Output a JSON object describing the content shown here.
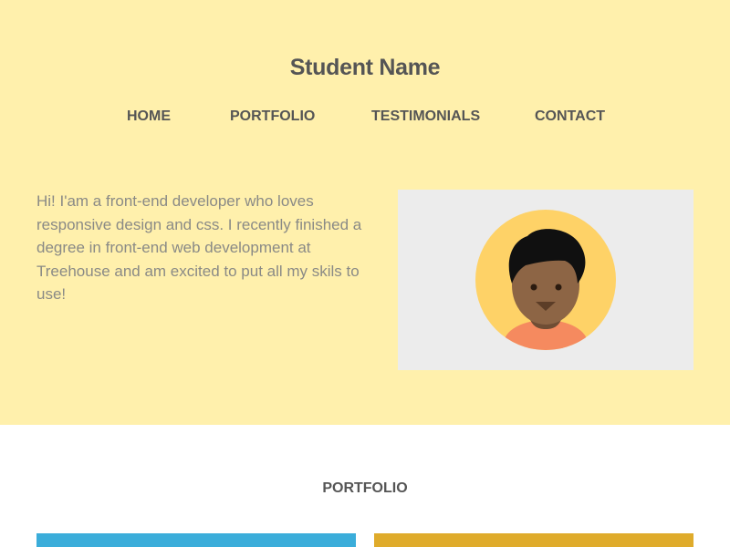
{
  "header": {
    "title": "Student Name"
  },
  "nav": {
    "items": [
      {
        "label": "HOME"
      },
      {
        "label": "PORTFOLIO"
      },
      {
        "label": "TESTIMONIALS"
      },
      {
        "label": "CONTACT"
      }
    ]
  },
  "hero": {
    "intro_text": "Hi! I'am a front-end developer who loves responsive design and css. I recently finished a degree in front-end web development at Treehouse and am excited to put all my skils to use!",
    "avatar_icon": "avatar-icon"
  },
  "portfolio": {
    "heading": "PORTFOLIO"
  },
  "colors": {
    "hero_background": "#fff0ac",
    "text_dark": "#555555",
    "text_muted": "#8a8a86",
    "card_blue": "#3badda",
    "card_gold": "#dfab2b",
    "avatar_background": "#fed267",
    "avatar_skin": "#8d6545",
    "avatar_shirt": "#f58a5f"
  }
}
